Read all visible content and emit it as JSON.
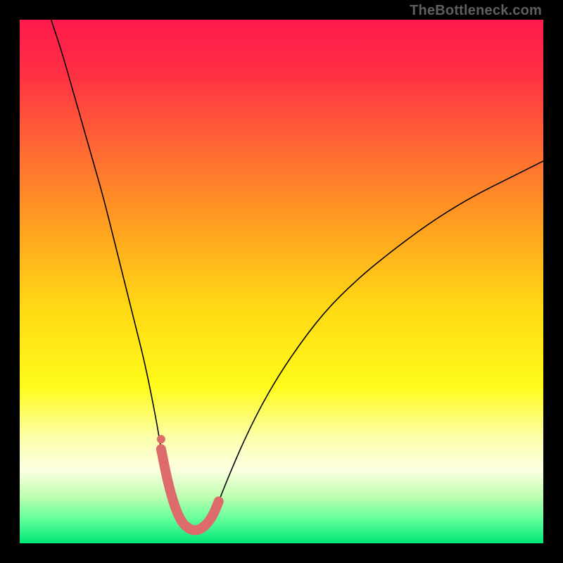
{
  "watermark": "TheBottleneck.com",
  "chart_data": {
    "type": "line",
    "title": "",
    "xlabel": "",
    "ylabel": "",
    "xlim": [
      0,
      100
    ],
    "ylim": [
      0,
      100
    ],
    "grid": false,
    "gradient_stops": [
      {
        "offset": 0.0,
        "color": "#ff1a4d"
      },
      {
        "offset": 0.1,
        "color": "#ff2f44"
      },
      {
        "offset": 0.25,
        "color": "#ff6a33"
      },
      {
        "offset": 0.4,
        "color": "#ffa21f"
      },
      {
        "offset": 0.55,
        "color": "#ffd914"
      },
      {
        "offset": 0.7,
        "color": "#fffb1a"
      },
      {
        "offset": 0.8,
        "color": "#fbffad"
      },
      {
        "offset": 0.86,
        "color": "#fdffe2"
      },
      {
        "offset": 0.91,
        "color": "#bfffb0"
      },
      {
        "offset": 0.955,
        "color": "#5fff9a"
      },
      {
        "offset": 1.0,
        "color": "#00e676"
      }
    ],
    "series": [
      {
        "name": "bottleneck-curve",
        "color": "#000000",
        "width": 1.6,
        "x": [
          6,
          8,
          10,
          12,
          14,
          16,
          18,
          20,
          22,
          24,
          26,
          27,
          28,
          29,
          30,
          31,
          32,
          33,
          34,
          35,
          36,
          37,
          38,
          40,
          43,
          47,
          52,
          58,
          64,
          70,
          78,
          86,
          94,
          100
        ],
        "y": [
          100,
          94,
          87,
          80,
          73,
          66,
          58,
          50,
          42,
          34,
          24,
          18,
          13,
          9,
          6,
          4,
          3,
          2.5,
          2.5,
          3,
          4,
          5.5,
          8,
          13,
          20,
          28,
          36,
          44,
          50,
          55,
          61,
          66,
          70,
          73
        ]
      },
      {
        "name": "salmon-marker",
        "color": "#dd6b6b",
        "type": "marker-band",
        "x": [
          27,
          28,
          29,
          30,
          31,
          32,
          33,
          34,
          35,
          36,
          37,
          38
        ],
        "y": [
          18,
          13,
          9,
          6,
          4,
          3,
          2.5,
          2.5,
          3,
          4,
          5.5,
          8
        ]
      }
    ]
  }
}
